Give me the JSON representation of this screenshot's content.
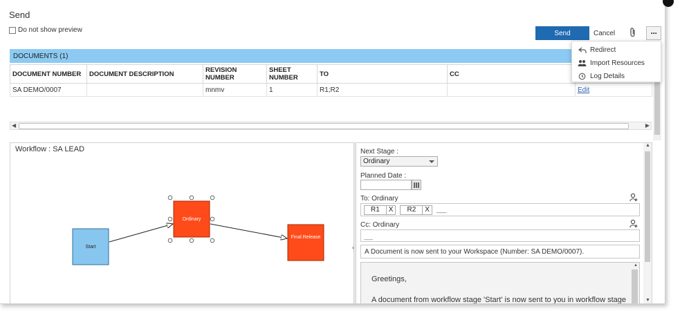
{
  "dialog": {
    "title": "Send",
    "do_not_show_preview": "Do not show preview",
    "send_label": "Send",
    "cancel_label": "Cancel",
    "more_label": "···"
  },
  "more_menu": [
    {
      "label": "Redirect",
      "icon": "redirect-icon"
    },
    {
      "label": "Import Resources",
      "icon": "users-icon"
    },
    {
      "label": "Log Details",
      "icon": "history-icon"
    }
  ],
  "documents": {
    "header": "DOCUMENTS (1)",
    "columns": [
      "DOCUMENT NUMBER",
      "DOCUMENT DESCRIPTION",
      "REVISION NUMBER",
      "SHEET NUMBER",
      "TO",
      "CC",
      ""
    ],
    "rows": [
      {
        "number": "SA DEMO/0007",
        "description": "",
        "revision": "mnmv",
        "sheet": "1",
        "to": "R1;R2",
        "cc": "",
        "action": "Edit"
      }
    ]
  },
  "workflow": {
    "title": "Workflow : SA LEAD",
    "nodes": [
      {
        "label": "Start",
        "color": "#87c6ef"
      },
      {
        "label": "Ordinary",
        "color": "#ff4a1a"
      },
      {
        "label": "Final Release",
        "color": "#ff4a1a"
      }
    ]
  },
  "form": {
    "next_stage_label": "Next Stage :",
    "next_stage_value": "Ordinary",
    "planned_date_label": "Planned Date :",
    "to_label": "To: Ordinary",
    "to_recipients": [
      {
        "name": "R1",
        "remove": "X"
      },
      {
        "name": "R2",
        "remove": "X"
      }
    ],
    "to_placeholder": "___",
    "cc_label": "Cc: Ordinary",
    "cc_placeholder": "___",
    "subject": "A Document is now sent to your Workspace (Number: SA DEMO/0007).",
    "body_greeting": "Greetings,",
    "body_line": "A document from workflow stage 'Start' is now sent to you in workflow stage"
  },
  "colors": {
    "accent": "#1f6ab1",
    "documents_header": "#8ccaf3",
    "stage_active": "#ff4a1a",
    "stage_start": "#87c6ef"
  }
}
